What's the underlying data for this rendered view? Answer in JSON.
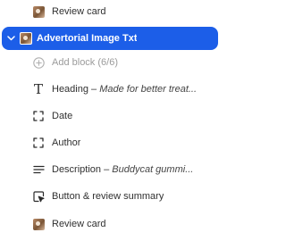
{
  "tree": {
    "review_card_top": {
      "label": "Review card",
      "icon": "image-thumbnail-icon"
    },
    "section": {
      "label": "Advertorial Image Txt",
      "expanded": true,
      "accent": "#1c5ee8",
      "icon": "image-thumbnail-icon"
    },
    "add_block": {
      "label": "Add block (6/6)",
      "icon": "plus-circle-icon"
    },
    "blocks": [
      {
        "type": "Heading",
        "detail": "Made for better treat...",
        "icon": "text-t-icon"
      },
      {
        "type": "Date",
        "detail": "",
        "icon": "dashed-square-icon"
      },
      {
        "type": "Author",
        "detail": "",
        "icon": "dashed-square-icon"
      },
      {
        "type": "Description",
        "detail": "Buddycat gummi...",
        "icon": "paragraph-lines-icon"
      },
      {
        "type": "Button & review summary",
        "detail": "",
        "icon": "cursor-click-icon"
      },
      {
        "type": "Review card",
        "detail": "",
        "icon": "image-thumbnail-icon"
      }
    ],
    "separator": " – "
  }
}
